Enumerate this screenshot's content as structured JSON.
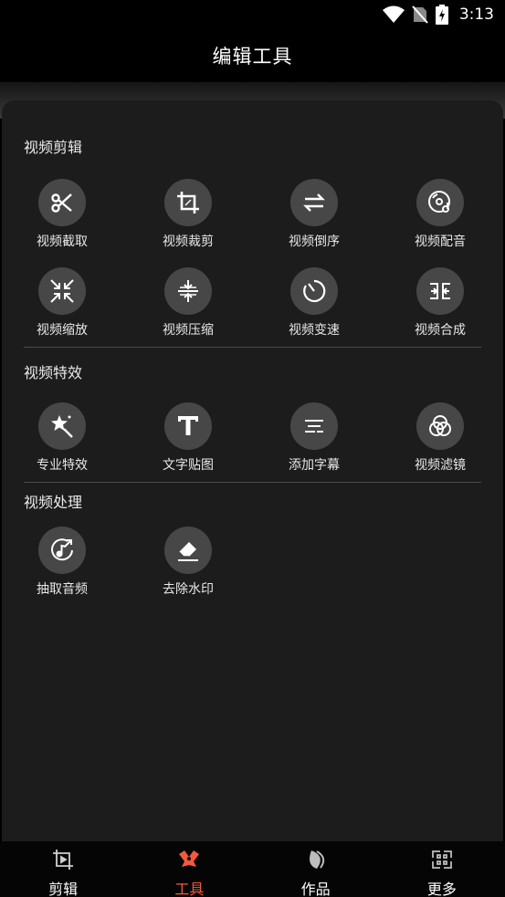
{
  "status_bar": {
    "time": "3:13"
  },
  "header": {
    "title": "编辑工具"
  },
  "sections": [
    {
      "title": "视频剪辑",
      "tools": [
        {
          "label": "视频截取",
          "icon": "scissors-icon"
        },
        {
          "label": "视频裁剪",
          "icon": "crop-icon"
        },
        {
          "label": "视频倒序",
          "icon": "swap-arrows-icon"
        },
        {
          "label": "视频配音",
          "icon": "music-disc-icon"
        },
        {
          "label": "视频缩放",
          "icon": "shrink-icon"
        },
        {
          "label": "视频压缩",
          "icon": "compress-icon"
        },
        {
          "label": "视频变速",
          "icon": "timer-icon"
        },
        {
          "label": "视频合成",
          "icon": "merge-icon"
        }
      ]
    },
    {
      "title": "视频特效",
      "tools": [
        {
          "label": "专业特效",
          "icon": "magic-wand-icon"
        },
        {
          "label": "文字贴图",
          "icon": "text-icon"
        },
        {
          "label": "添加字幕",
          "icon": "subtitle-icon"
        },
        {
          "label": "视频滤镜",
          "icon": "filter-circles-icon"
        }
      ]
    },
    {
      "title": "视频处理",
      "tools": [
        {
          "label": "抽取音频",
          "icon": "audio-extract-icon"
        },
        {
          "label": "去除水印",
          "icon": "eraser-icon"
        }
      ]
    }
  ],
  "bottom_nav": [
    {
      "label": "剪辑",
      "icon": "crop-video-icon",
      "active": false
    },
    {
      "label": "工具",
      "icon": "tools-icon",
      "active": true
    },
    {
      "label": "作品",
      "icon": "works-icon",
      "active": false
    },
    {
      "label": "更多",
      "icon": "more-grid-icon",
      "active": false
    }
  ],
  "colors": {
    "accent": "#f25a3c",
    "panel": "#1c1c1c",
    "icon_bg": "#474747"
  }
}
